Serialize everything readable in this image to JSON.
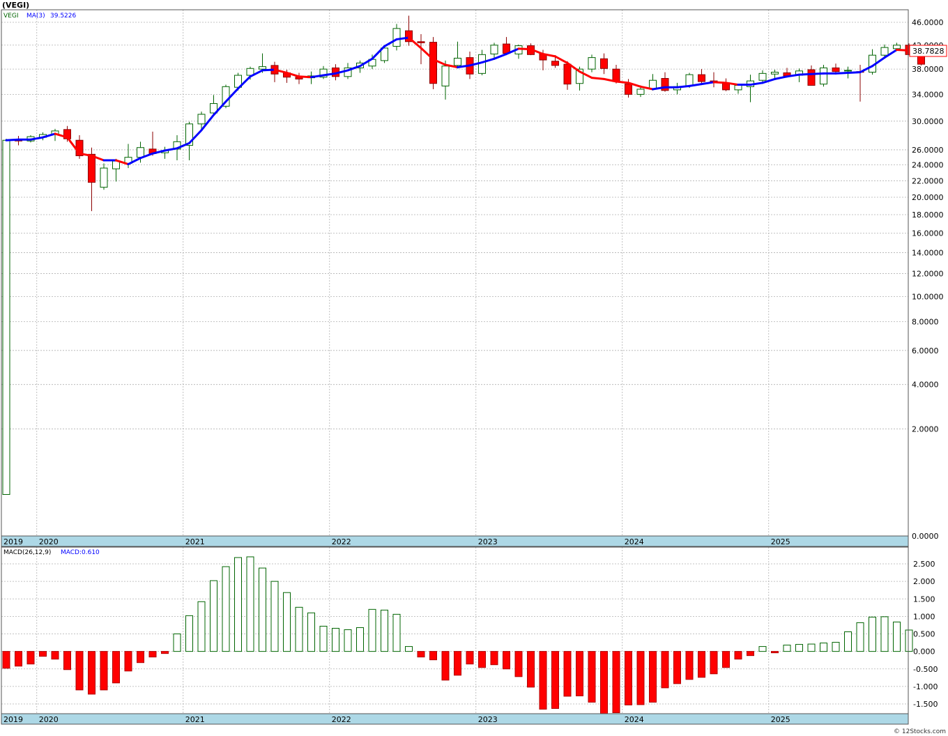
{
  "header": {
    "title": "(VEGI)"
  },
  "legend": {
    "symbol": "VEGI",
    "ma_label": "MA(3)",
    "ma_value": "39.5226"
  },
  "macd_legend": {
    "label": "MACD(26,12,9)",
    "value_label": "MACD:0.610"
  },
  "last_price_label": "38.7828",
  "watermark": "© 12Stocks.com",
  "colors": {
    "up_candle": "#006400",
    "down_candle": "#ff0000",
    "ma_up": "#0000ff",
    "ma_down": "#ff0000",
    "axis_band": "#add8e6",
    "grid": "#b0b0b0"
  },
  "chart_data": [
    {
      "type": "candlestick",
      "title": "(VEGI)",
      "y_scale": "sqrt",
      "ylim": [
        0,
        48
      ],
      "y_ticks": [
        "46.0000",
        "42.0000",
        "38.0000",
        "34.0000",
        "30.0000",
        "26.0000",
        "24.0000",
        "22.0000",
        "20.0000",
        "18.0000",
        "16.0000",
        "14.0000",
        "12.0000",
        "10.0000",
        "8.0000",
        "6.0000",
        "4.0000",
        "2.0000",
        "0.0000"
      ],
      "x_tick_labels": [
        "2019",
        "2020",
        "2021",
        "2022",
        "2023",
        "2024",
        "2025"
      ],
      "x_tick_months": [
        0,
        3,
        15,
        27,
        39,
        51,
        63
      ],
      "start": "2019-10",
      "grid": true,
      "candles": [
        [
          0.3,
          27.5,
          0.3,
          27.3
        ],
        [
          27.3,
          27.9,
          26.6,
          27.2
        ],
        [
          27.2,
          28.0,
          27.0,
          27.8
        ],
        [
          27.7,
          28.4,
          27.3,
          28.1
        ],
        [
          28.1,
          28.9,
          27.2,
          28.6
        ],
        [
          28.8,
          29.3,
          27.1,
          27.5
        ],
        [
          27.3,
          28.0,
          24.8,
          25.2
        ],
        [
          25.4,
          26.3,
          18.4,
          21.8
        ],
        [
          21.2,
          24.2,
          20.9,
          23.6
        ],
        [
          23.5,
          24.8,
          21.9,
          24.5
        ],
        [
          24.2,
          26.8,
          23.6,
          25.0
        ],
        [
          25.0,
          27.1,
          24.3,
          26.3
        ],
        [
          26.1,
          28.5,
          25.2,
          25.5
        ],
        [
          25.6,
          26.4,
          24.8,
          25.9
        ],
        [
          26.1,
          28.0,
          24.6,
          27.1
        ],
        [
          26.6,
          29.9,
          24.6,
          29.6
        ],
        [
          29.6,
          31.4,
          28.6,
          31.0
        ],
        [
          31.2,
          33.9,
          31.0,
          32.6
        ],
        [
          32.2,
          35.5,
          31.9,
          35.2
        ],
        [
          35.1,
          37.4,
          34.6,
          37.0
        ],
        [
          37.0,
          38.4,
          36.3,
          38.1
        ],
        [
          38.0,
          40.6,
          37.4,
          38.4
        ],
        [
          38.6,
          39.2,
          35.9,
          37.2
        ],
        [
          37.4,
          37.9,
          35.8,
          36.7
        ],
        [
          36.7,
          37.4,
          35.6,
          36.4
        ],
        [
          36.6,
          37.6,
          35.6,
          36.9
        ],
        [
          36.7,
          38.5,
          36.4,
          38.0
        ],
        [
          38.2,
          38.8,
          36.2,
          36.8
        ],
        [
          36.8,
          39.0,
          36.4,
          38.2
        ],
        [
          38.2,
          39.4,
          37.4,
          39.0
        ],
        [
          38.5,
          40.4,
          38.0,
          39.6
        ],
        [
          39.4,
          41.9,
          39.0,
          41.5
        ],
        [
          41.8,
          45.7,
          41.1,
          44.9
        ],
        [
          44.5,
          47.2,
          41.9,
          42.6
        ],
        [
          42.6,
          43.9,
          38.8,
          42.4
        ],
        [
          42.5,
          43.4,
          34.8,
          35.7
        ],
        [
          35.3,
          39.4,
          33.2,
          38.5
        ],
        [
          38.6,
          42.6,
          38.1,
          39.8
        ],
        [
          39.9,
          40.9,
          36.4,
          37.2
        ],
        [
          37.3,
          41.2,
          37.0,
          40.4
        ],
        [
          40.5,
          42.4,
          39.6,
          42.0
        ],
        [
          42.2,
          43.4,
          40.3,
          40.6
        ],
        [
          40.5,
          42.1,
          39.7,
          41.9
        ],
        [
          41.9,
          42.3,
          40.3,
          40.4
        ],
        [
          40.5,
          41.2,
          37.8,
          39.5
        ],
        [
          39.3,
          40.3,
          38.2,
          38.6
        ],
        [
          38.8,
          39.3,
          34.7,
          35.6
        ],
        [
          35.7,
          38.4,
          34.6,
          38.0
        ],
        [
          38.0,
          40.4,
          37.5,
          39.9
        ],
        [
          39.7,
          40.6,
          37.2,
          38.1
        ],
        [
          38.0,
          38.7,
          35.7,
          36.0
        ],
        [
          35.6,
          36.4,
          33.5,
          34.0
        ],
        [
          34.0,
          35.4,
          33.6,
          34.8
        ],
        [
          34.8,
          37.2,
          34.6,
          36.2
        ],
        [
          36.5,
          37.5,
          34.4,
          34.6
        ],
        [
          34.7,
          35.8,
          34.0,
          35.2
        ],
        [
          35.3,
          37.4,
          35.0,
          37.1
        ],
        [
          37.1,
          38.0,
          35.6,
          36.0
        ],
        [
          36.1,
          37.5,
          35.1,
          35.9
        ],
        [
          35.7,
          36.5,
          34.5,
          34.7
        ],
        [
          34.7,
          35.6,
          34.1,
          35.4
        ],
        [
          35.2,
          37.1,
          32.8,
          36.1
        ],
        [
          36.2,
          37.8,
          35.9,
          37.3
        ],
        [
          37.2,
          37.9,
          36.5,
          37.5
        ],
        [
          37.4,
          38.2,
          37.0,
          36.9
        ],
        [
          37.0,
          38.1,
          35.9,
          37.7
        ],
        [
          37.9,
          38.6,
          36.2,
          35.4
        ],
        [
          35.6,
          38.7,
          35.2,
          38.2
        ],
        [
          38.2,
          38.9,
          37.4,
          37.6
        ],
        [
          37.8,
          38.4,
          36.5,
          37.8
        ],
        [
          37.6,
          38.7,
          32.9,
          37.5
        ],
        [
          37.5,
          41.3,
          37.1,
          40.3
        ],
        [
          40.3,
          42.1,
          39.9,
          41.6
        ],
        [
          41.4,
          42.4,
          41.0,
          42.0
        ],
        [
          42.0,
          42.3,
          40.3,
          40.4
        ],
        [
          40.6,
          41.0,
          38.6,
          38.8
        ]
      ],
      "ma3": [
        27.3,
        27.4,
        27.4,
        27.7,
        28.2,
        27.7,
        25.5,
        25.2,
        24.6,
        24.6,
        24.1,
        24.9,
        25.5,
        25.9,
        26.2,
        26.9,
        28.7,
        30.9,
        32.9,
        34.9,
        36.8,
        37.8,
        37.9,
        37.4,
        36.8,
        36.7,
        37.0,
        37.3,
        37.8,
        38.5,
        39.7,
        41.8,
        43.0,
        43.3,
        41.5,
        39.6,
        38.7,
        38.3,
        38.6,
        39.1,
        39.7,
        40.5,
        41.4,
        41.3,
        40.5,
        40.1,
        39.0,
        37.6,
        36.6,
        36.4,
        36.0,
        35.8,
        35.2,
        34.8,
        35.1,
        35.1,
        35.3,
        35.6,
        35.9,
        35.8,
        35.5,
        35.5,
        35.8,
        36.4,
        36.8,
        37.1,
        37.2,
        37.3,
        37.3,
        37.4,
        37.5,
        38.5,
        39.9,
        41.2,
        41.1,
        40.4
      ],
      "y_axis_price_label": "38.7828"
    },
    {
      "type": "bar",
      "title": "MACD(26,12,9)",
      "ylim": [
        -1.75,
        2.85
      ],
      "y_ticks": [
        "2.500",
        "2.000",
        "1.500",
        "1.000",
        "0.500",
        "0.000",
        "-0.500",
        "-1.000",
        "-1.500"
      ],
      "x_tick_labels": [
        "2019",
        "2020",
        "2021",
        "2022",
        "2023",
        "2024",
        "2025"
      ],
      "values": [
        -0.48,
        -0.42,
        -0.36,
        -0.14,
        -0.22,
        -0.52,
        -1.1,
        -1.22,
        -1.1,
        -0.9,
        -0.56,
        -0.32,
        -0.16,
        -0.06,
        0.5,
        1.02,
        1.42,
        2.02,
        2.42,
        2.68,
        2.7,
        2.38,
        2.0,
        1.68,
        1.26,
        1.1,
        0.72,
        0.66,
        0.62,
        0.68,
        1.2,
        1.18,
        1.06,
        0.14,
        -0.16,
        -0.24,
        -0.82,
        -0.68,
        -0.36,
        -0.46,
        -0.38,
        -0.5,
        -0.72,
        -1.02,
        -1.65,
        -1.63,
        -1.28,
        -1.27,
        -1.45,
        -1.78,
        -1.75,
        -1.53,
        -1.52,
        -1.45,
        -1.04,
        -0.92,
        -0.8,
        -0.74,
        -0.64,
        -0.46,
        -0.22,
        -0.12,
        0.14,
        -0.04,
        0.18,
        0.2,
        0.21,
        0.24,
        0.26,
        0.56,
        0.82,
        0.98,
        0.99,
        0.84,
        0.61
      ]
    }
  ]
}
